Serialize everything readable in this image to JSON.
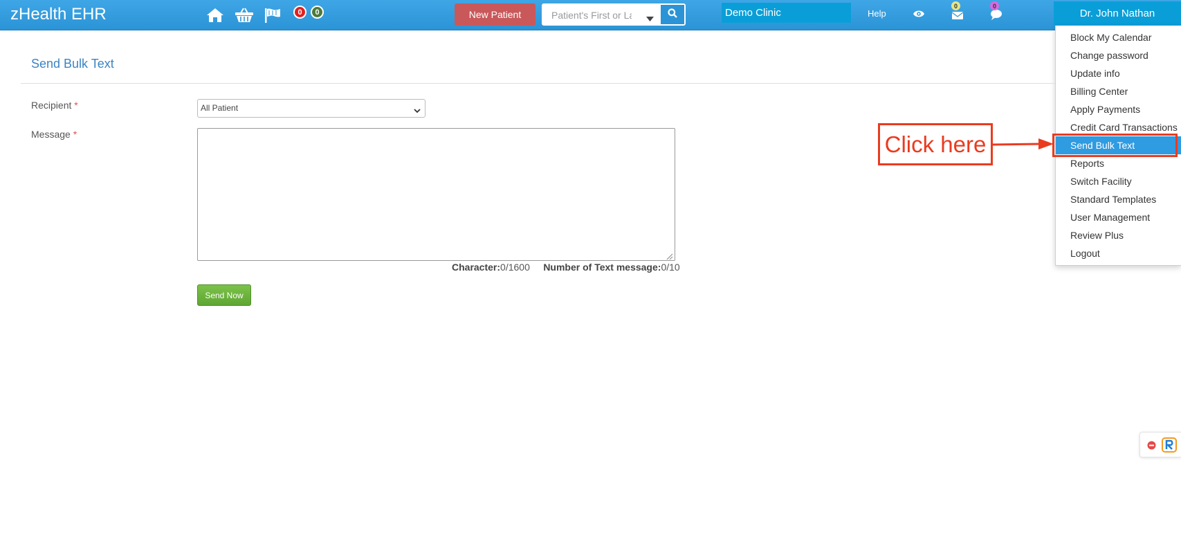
{
  "header": {
    "brand": "zHealth EHR",
    "badge_red_count": "0",
    "badge_green_count": "0",
    "new_patient_label": "New Patient",
    "search_placeholder": "Patient's First or La",
    "clinic_name": "Demo Clinic",
    "help_label": "Help",
    "mail_count": "0",
    "chat_count": "0",
    "user_name": "Dr. John Nathan",
    "icons": [
      "home-icon",
      "basket-icon",
      "flag-icon",
      "eye-icon",
      "envelope-icon",
      "chat-icon",
      "search-icon"
    ]
  },
  "user_menu": {
    "items": [
      {
        "label": "Block My Calendar"
      },
      {
        "label": "Change password"
      },
      {
        "label": "Update info"
      },
      {
        "label": "Billing Center"
      },
      {
        "label": "Apply Payments"
      },
      {
        "label": "Credit Card Transactions"
      },
      {
        "label": "Send Bulk Text"
      },
      {
        "label": "Reports"
      },
      {
        "label": "Switch Facility"
      },
      {
        "label": "Standard Templates"
      },
      {
        "label": "User Management"
      },
      {
        "label": "Review Plus"
      },
      {
        "label": "Logout"
      }
    ],
    "active_item": "Send Bulk Text"
  },
  "page": {
    "title": "Send Bulk Text",
    "recipient_label": "Recipient",
    "recipient_value": "All Patient",
    "message_label": "Message",
    "message_value": "",
    "required_mark": "*",
    "character_label": "Character:",
    "character_value": "0/1600",
    "text_count_label": "Number of Text message:",
    "text_count_value": "0/10",
    "send_button": "Send Now"
  },
  "annotation": {
    "callout_text": "Click here",
    "color": "#ea3b1f"
  },
  "colors": {
    "topbar": "#2b94d6",
    "accent": "#0a9ed8",
    "new_patient": "#c9585a",
    "send_button": "#6ab43c",
    "title": "#3b83c4",
    "menu_active": "#2f9be0"
  }
}
